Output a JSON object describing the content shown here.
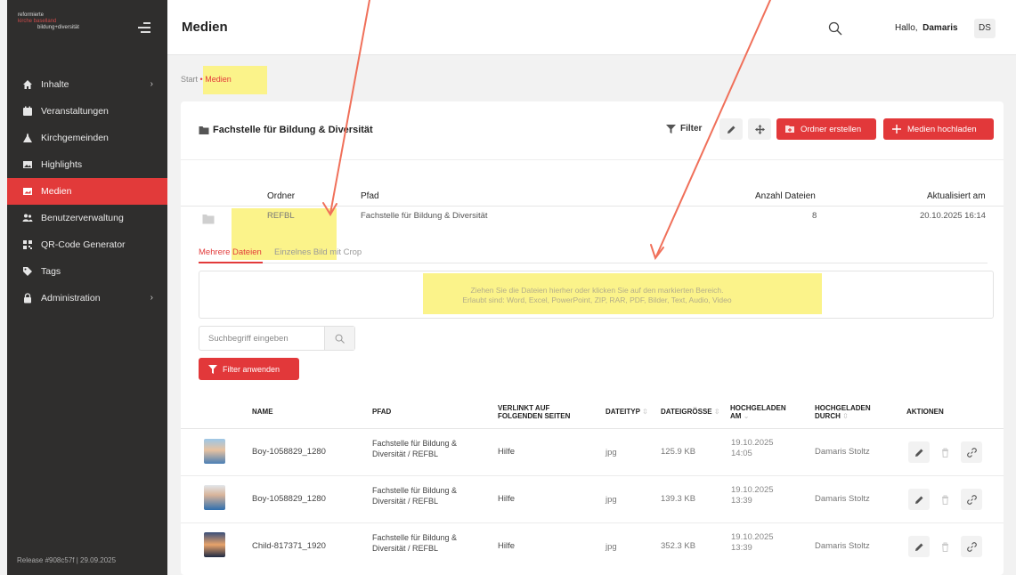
{
  "sidebar": {
    "logo_lines": [
      "reformierte",
      "kirche baselland",
      "bildung+diversität"
    ],
    "items": [
      {
        "label": "Inhalte",
        "icon": "home-icon",
        "chevron": "›"
      },
      {
        "label": "Veranstaltungen",
        "icon": "calendar-icon"
      },
      {
        "label": "Kirchgemeinden",
        "icon": "church-icon"
      },
      {
        "label": "Highlights",
        "icon": "image-icon"
      },
      {
        "label": "Medien",
        "icon": "media-icon",
        "active": true
      },
      {
        "label": "Benutzerverwaltung",
        "icon": "users-icon"
      },
      {
        "label": "QR-Code Generator",
        "icon": "qr-icon"
      },
      {
        "label": "Tags",
        "icon": "tag-icon"
      },
      {
        "label": "Administration",
        "icon": "lock-icon",
        "chevron": "›"
      }
    ],
    "release": "Release #908c57f | 29.09.2025"
  },
  "header": {
    "title": "Medien",
    "greeting": "Hallo,",
    "user_name": "Damaris",
    "avatar_initials": "DS"
  },
  "breadcrumb": {
    "start": "Start",
    "separator": "•",
    "current": "Medien"
  },
  "folder_panel": {
    "title": "Fachstelle für Bildung & Diversität",
    "filter_label": "Filter",
    "create_folder_label": "Ordner erstellen",
    "upload_label": "Medien hochladen"
  },
  "folder_table": {
    "columns": [
      "Ordner",
      "Pfad",
      "Anzahl Dateien",
      "Aktualisiert am"
    ],
    "row": {
      "folder": "REFBL",
      "path": "Fachstelle für Bildung & Diversität",
      "count": "8",
      "updated": "20.10.2025 16:14"
    }
  },
  "tabs": [
    {
      "label": "Mehrere Dateien",
      "active": true
    },
    {
      "label": "Einzelnes Bild mit Crop"
    }
  ],
  "dropzone": {
    "line1": "Ziehen Sie die Dateien hierher oder klicken Sie auf den markierten Bereich.",
    "line2": "Erlaubt sind: Word, Excel, PowerPoint, ZIP, RAR, PDF, Bilder, Text, Audio, Video"
  },
  "search": {
    "placeholder": "Suchbegriff eingeben",
    "apply_label": "Filter anwenden"
  },
  "media_table": {
    "columns": {
      "name": "NAME",
      "path": "PFAD",
      "linked_1": "VERLINKT AUF",
      "linked_2": "FOLGENDEN SEITEN",
      "type": "DATEITYP",
      "size": "DATEIGRÖSSE",
      "uploaded_1": "HOCHGELADEN",
      "uploaded_2": "AM",
      "uploaded_by_1": "HOCHGELADEN",
      "uploaded_by_2": "DURCH",
      "actions": "AKTIONEN"
    },
    "rows": [
      {
        "name": "Boy-1058829_1280",
        "path_1": "Fachstelle für Bildung &",
        "path_2": "Diversität / REFBL",
        "linked": "Hilfe",
        "type": "jpg",
        "size": "125.9 KB",
        "date": "19.10.2025",
        "time": "14:05",
        "by": "Damaris Stoltz"
      },
      {
        "name": "Boy-1058829_1280",
        "path_1": "Fachstelle für Bildung &",
        "path_2": "Diversität / REFBL",
        "linked": "Hilfe",
        "type": "jpg",
        "size": "139.3 KB",
        "date": "19.10.2025",
        "time": "13:39",
        "by": "Damaris Stoltz"
      },
      {
        "name": "Child-817371_1920",
        "path_1": "Fachstelle für Bildung &",
        "path_2": "Diversität / REFBL",
        "linked": "Hilfe",
        "type": "jpg",
        "size": "352.3 KB",
        "date": "19.10.2025",
        "time": "13:39",
        "by": "Damaris Stoltz"
      }
    ]
  },
  "colors": {
    "accent": "#e2383a",
    "sidebar": "#2f2e2d",
    "highlight": "#fbf38a",
    "arrow": "#f0705a"
  }
}
